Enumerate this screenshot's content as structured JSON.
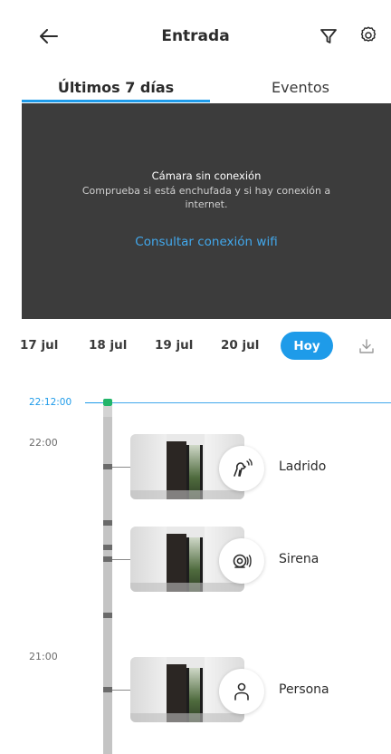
{
  "header": {
    "title": "Entrada",
    "back_icon": "arrow-left-icon",
    "filter_icon": "filter-icon",
    "settings_icon": "gear-icon"
  },
  "tabs": [
    {
      "label": "Últimos 7 días",
      "active": true
    },
    {
      "label": "Eventos",
      "active": false
    }
  ],
  "camera": {
    "title": "Cámara sin conexión",
    "description": "Comprueba si está enchufada y si hay conexión a internet.",
    "link": "Consultar conexión wifi"
  },
  "dates": [
    "17 jul",
    "18 jul",
    "19 jul",
    "20 jul"
  ],
  "today_label": "Hoy",
  "timeline": {
    "now": "22:12:00",
    "hours": [
      "22:00",
      "21:00"
    ],
    "events": [
      {
        "label": "Ladrido",
        "icon": "dog-bark-icon"
      },
      {
        "label": "Sirena",
        "icon": "siren-icon"
      },
      {
        "label": "Persona",
        "icon": "person-icon"
      }
    ]
  },
  "colors": {
    "accent": "#1e9be9",
    "panel": "#3c3c3c",
    "marker": "#22b56a"
  }
}
